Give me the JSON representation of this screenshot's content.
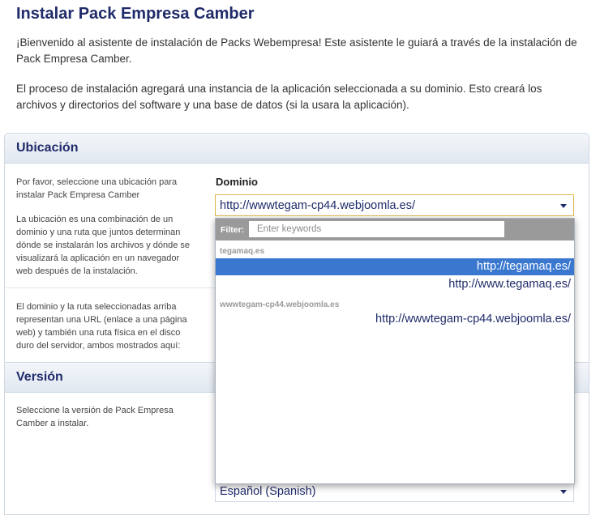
{
  "page": {
    "title": "Instalar Pack Empresa Camber",
    "intro_1": "¡Bienvenido al asistente de instalación de Packs Webempresa! Este asistente le guiará a través de la instalación de Pack Empresa Camber.",
    "intro_2": "El proceso de instalación agregará una instancia de la aplicación seleccionada a su dominio. Esto creará los archivos y directorios del software y una base de datos (si la usara la aplicación)."
  },
  "ubicacion": {
    "heading": "Ubicación",
    "help_1": "Por favor, seleccione una ubicación para instalar Pack Empresa Camber",
    "help_2": "La ubicación es una combinación de un dominio y una ruta que juntos determinan dónde se instalarán los archivos y dónde se visualizará la aplicación en un navegador web después de la instalación.",
    "help_3": "El dominio y la ruta seleccionadas arriba representan una URL (enlace a una página web) y también una ruta física en el disco duro del servidor, ambos mostrados aquí:",
    "domain_label": "Dominio",
    "domain_value": "http://wwwtegam-cp44.webjoomla.es/"
  },
  "dropdown": {
    "filter_label": "Filter:",
    "filter_placeholder": "Enter keywords",
    "groups": [
      {
        "label": "tegamaq.es",
        "options": [
          {
            "label": "http://tegamaq.es/",
            "selected": true
          },
          {
            "label": "http://www.tegamaq.es/",
            "selected": false
          }
        ]
      },
      {
        "label": "wwwtegam-cp44.webjoomla.es",
        "options": [
          {
            "label": "http://wwwtegam-cp44.webjoomla.es/",
            "selected": false
          }
        ]
      }
    ]
  },
  "version": {
    "heading": "Versión",
    "help": "Seleccione la versión de Pack Empresa Camber a instalar.",
    "language_value": "Español (Spanish)"
  },
  "colors": {
    "heading": "#1f2b6a",
    "selected_option": "#3a78cf",
    "select_focus_border": "#e2b64a",
    "filter_bar": "#9a9a9a"
  }
}
